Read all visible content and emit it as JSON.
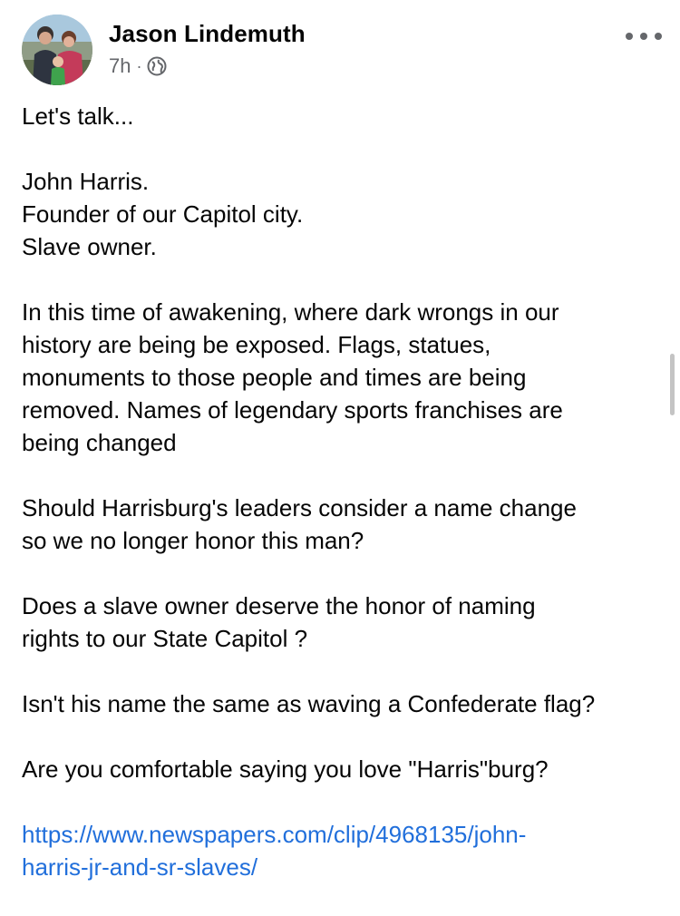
{
  "post": {
    "author": "Jason Lindemuth",
    "time": "7h",
    "privacy_icon": "globe-icon",
    "more_icon": "more-horizontal-icon",
    "paragraphs": [
      [
        "Let's talk..."
      ],
      [
        "John Harris.",
        "Founder of our Capitol city.",
        "Slave owner."
      ],
      [
        "In this time of awakening, where dark wrongs in our",
        "history are being be exposed. Flags, statues,",
        "monuments to those people and times are being",
        "removed. Names of legendary sports franchises are",
        "being changed"
      ],
      [
        "Should Harrisburg's leaders consider a name change",
        "so we no longer honor this man?"
      ],
      [
        "Does a slave owner deserve the honor of naming",
        "rights to our State Capitol ?"
      ],
      [
        "Isn't his name the same as waving a Confederate flag?"
      ],
      [
        "Are you comfortable saying you love \"Harris\"burg?"
      ]
    ],
    "link_lines": [
      "https://www.newspapers.com/clip/4968135/john-",
      "harris-jr-and-sr-slaves/"
    ]
  },
  "colors": {
    "text": "#050505",
    "secondary": "#65676b",
    "link": "#216fdb"
  }
}
